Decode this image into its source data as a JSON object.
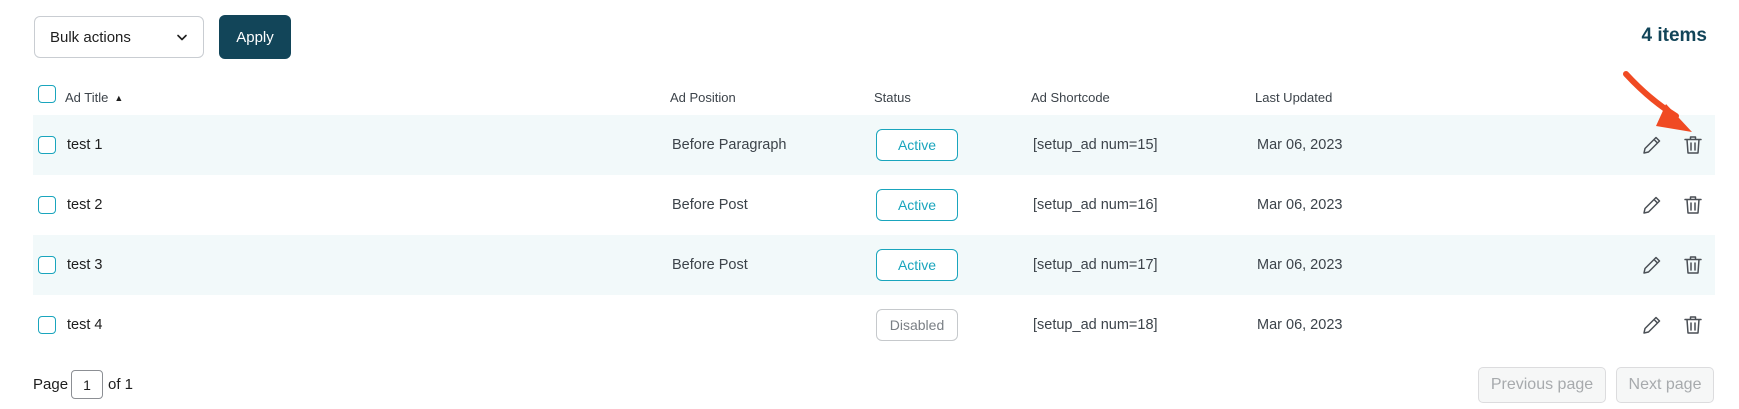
{
  "toolbar": {
    "bulk_actions": {
      "selected": "Bulk actions",
      "icon": "chevron-down-icon"
    },
    "apply_label": "Apply",
    "items_count": "4 items"
  },
  "table": {
    "columns": {
      "title": "Ad Title",
      "position": "Ad Position",
      "status": "Status",
      "shortcode": "Ad Shortcode",
      "updated": "Last Updated"
    },
    "sort": {
      "column": "Ad Title",
      "direction": "ascending",
      "icon": "sort-up-icon"
    },
    "rows": [
      {
        "title": "test 1",
        "position": "Before Paragraph",
        "status": "Active",
        "shortcode": "[setup_ad num=15]",
        "updated": "Mar 06, 2023"
      },
      {
        "title": "test 2",
        "position": "Before Post",
        "status": "Active",
        "shortcode": "[setup_ad num=16]",
        "updated": "Mar 06, 2023"
      },
      {
        "title": "test 3",
        "position": "Before Post",
        "status": "Active",
        "shortcode": "[setup_ad num=17]",
        "updated": "Mar 06, 2023"
      },
      {
        "title": "test 4",
        "position": "",
        "status": "Disabled",
        "shortcode": "[setup_ad num=18]",
        "updated": "Mar 06, 2023"
      }
    ],
    "row_actions": {
      "edit_icon": "pencil-icon",
      "delete_icon": "trash-icon"
    }
  },
  "pagination": {
    "page_label": "Page",
    "current_page": "1",
    "of_label": "of 1",
    "prev_label": "Previous page",
    "next_label": "Next page"
  },
  "colors": {
    "primary": "#124559",
    "accent": "#1aa5bd",
    "row_stripe": "#f2f9fa",
    "annotation": "#f04a23"
  }
}
